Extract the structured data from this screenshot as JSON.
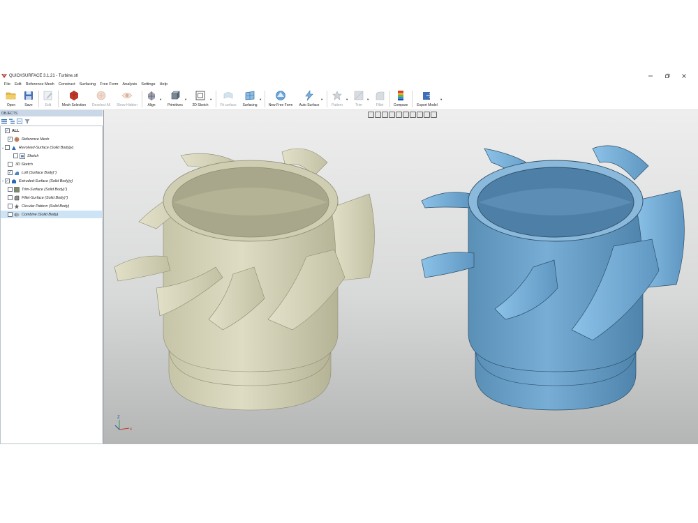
{
  "window": {
    "title": "QUICKSURFACE 3.1.21 - Turbine.stl",
    "controls": [
      "minimize",
      "restore",
      "close"
    ]
  },
  "menu": [
    "File",
    "Edit",
    "Reference Mesh",
    "Construct",
    "Surfacing",
    "Free Form",
    "Analysis",
    "Settings",
    "Help"
  ],
  "toolbar": {
    "open": "Open",
    "save": "Save",
    "edit": "Edit",
    "mesh_selection": "Mesh Selection",
    "deselect_all": "Deselect All",
    "show_hidden": "Show Hidden",
    "align": "Align",
    "primitives": "Primitives",
    "sketch2d": "2D Sketch",
    "fit_surface": "Fit surface",
    "surfacing": "Surfacing",
    "new_free_form": "New Free Form",
    "auto_surface": "Auto Surface",
    "pattern": "Pattern",
    "trim": "Trim",
    "fillet": "Fillet",
    "compare": "Compare",
    "export_model": "Export Model"
  },
  "objects_panel": {
    "header": "OBJECTS",
    "items": [
      {
        "label": "ALL",
        "checked": true
      },
      {
        "label": "Reference Mesh",
        "checked": true
      },
      {
        "label": "Revolved-Surface (Solid Body)y)",
        "checked": false,
        "expanded": true
      },
      {
        "label": "Sketch",
        "checked": false
      },
      {
        "label": "3D Sketch",
        "checked": false
      },
      {
        "label": "Loft (Surface Body)\")",
        "checked": true
      },
      {
        "label": "Extruded-Surface (Solid Body)y)",
        "checked": true,
        "collapsed": true
      },
      {
        "label": "Trim-Surface (Solid Body)\")",
        "checked": false
      },
      {
        "label": "Fillet-Surface (Solid Body)\")",
        "checked": false
      },
      {
        "label": "Circular Pattern (Solid Body)",
        "checked": false
      },
      {
        "label": "Combine (Solid Body)",
        "checked": false,
        "selected": true
      }
    ]
  },
  "viewport": {
    "background_top": "#eeeeee",
    "background_bottom": "#b4b5b5",
    "mesh_color": "#d9d7bf",
    "cad_color": "#6fa7cf",
    "axis_labels": [
      "Z",
      "x"
    ]
  },
  "colors": {
    "accent": "#2a6ab0",
    "header_bg": "#c9d7e6",
    "selected_row": "#cde4f7"
  }
}
